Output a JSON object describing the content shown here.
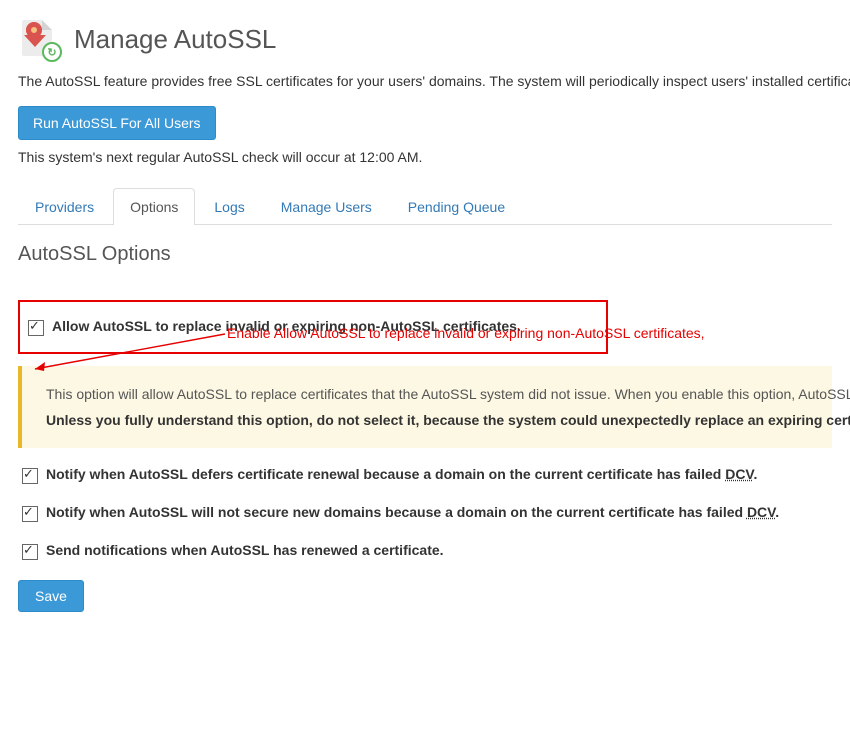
{
  "header": {
    "title": "Manage AutoSSL",
    "description": "The AutoSSL feature provides free SSL certificates for your users' domains. The system will periodically inspect users' installed certificates. Users who do not have the \"autossl\" feature will not receive the free certificates.",
    "button_label": "Run AutoSSL For All Users",
    "schedule_text": "This system's next regular AutoSSL check will occur at 12:00 AM."
  },
  "tabs": [
    {
      "label": "Providers",
      "active": false
    },
    {
      "label": "Options",
      "active": true
    },
    {
      "label": "Logs",
      "active": false
    },
    {
      "label": "Manage Users",
      "active": false
    },
    {
      "label": "Pending Queue",
      "active": false
    }
  ],
  "section_title": "AutoSSL Options",
  "annotation": {
    "text": "Enable Allow AutoSSL to replace invalid or expiring non-AutoSSL certificates,"
  },
  "options": {
    "replace_cert": {
      "label": "Allow AutoSSL to replace invalid or expiring non-AutoSSL certificates.",
      "checked": true,
      "info_line1": "This option will allow AutoSSL to replace certificates that the AutoSSL system did not issue. When you enable this option, AutoSSL ...",
      "info_warning": "Unless you fully understand this option, do not select it, because the system could unexpectedly replace an expiring certificate."
    },
    "notify_defer": {
      "label_prefix": "Notify when AutoSSL defers certificate renewal because a domain on the current certificate has failed ",
      "dcv": "DCV",
      "label_suffix": ".",
      "checked": true
    },
    "notify_nosecure": {
      "label_prefix": "Notify when AutoSSL will not secure new domains because a domain on the current certificate has failed ",
      "dcv": "DCV",
      "label_suffix": ".",
      "checked": true
    },
    "notify_renewed": {
      "label": "Send notifications when AutoSSL has renewed a certificate.",
      "checked": true
    }
  },
  "save_label": "Save",
  "icon": {
    "badge_glyph": "↻"
  }
}
